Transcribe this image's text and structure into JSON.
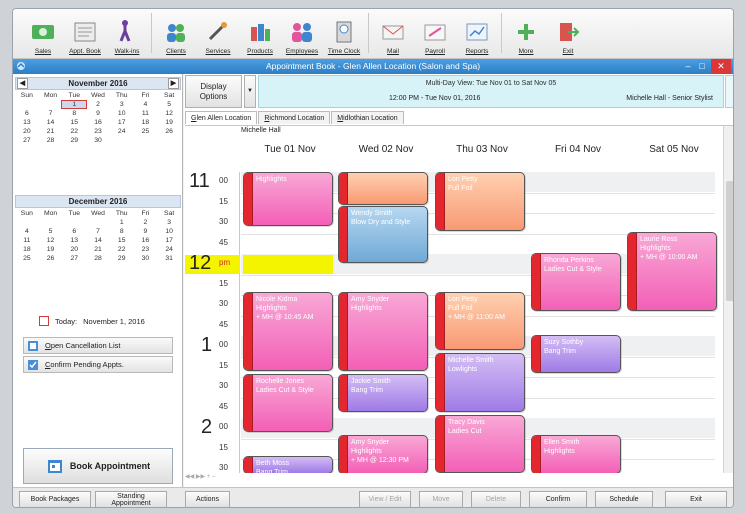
{
  "toolbar": [
    {
      "label": "Sales",
      "icon": "sales-icon"
    },
    {
      "label": "Appt. Book",
      "icon": "appt-book-icon"
    },
    {
      "label": "Walk-ins",
      "icon": "walk-ins-icon"
    },
    {
      "label": "Clients",
      "icon": "clients-icon"
    },
    {
      "label": "Services",
      "icon": "services-icon"
    },
    {
      "label": "Products",
      "icon": "products-icon"
    },
    {
      "label": "Employees",
      "icon": "employees-icon"
    },
    {
      "label": "Time Clock",
      "icon": "time-clock-icon"
    },
    {
      "label": "Mail",
      "icon": "mail-icon"
    },
    {
      "label": "Payroll",
      "icon": "payroll-icon"
    },
    {
      "label": "Reports",
      "icon": "reports-icon"
    },
    {
      "label": "More",
      "icon": "more-icon"
    },
    {
      "label": "Exit",
      "icon": "exit-icon"
    }
  ],
  "window": {
    "title": "Appointment Book - Glen Allen Location (Salon and Spa)"
  },
  "left": {
    "nov": {
      "title": "November 2016",
      "dow": [
        "Sun",
        "Mon",
        "Tue",
        "Wed",
        "Thu",
        "Fri",
        "Sat"
      ],
      "days": [
        "",
        "",
        "1",
        "2",
        "3",
        "4",
        "5",
        "6",
        "7",
        "8",
        "9",
        "10",
        "11",
        "12",
        "13",
        "14",
        "15",
        "16",
        "17",
        "18",
        "19",
        "20",
        "21",
        "22",
        "23",
        "24",
        "25",
        "26",
        "27",
        "28",
        "29",
        "30",
        "",
        "",
        ""
      ]
    },
    "dec": {
      "title": "December 2016",
      "dow": [
        "Sun",
        "Mon",
        "Tue",
        "Wed",
        "Thu",
        "Fri",
        "Sat"
      ],
      "days": [
        "",
        "",
        "",
        "",
        "1",
        "2",
        "3",
        "4",
        "5",
        "6",
        "7",
        "8",
        "9",
        "10",
        "11",
        "12",
        "13",
        "14",
        "15",
        "16",
        "17",
        "18",
        "19",
        "20",
        "21",
        "22",
        "23",
        "24",
        "25",
        "26",
        "27",
        "28",
        "29",
        "30",
        "31"
      ]
    },
    "today_label": "Today:",
    "today_date": "November 1, 2016",
    "open_cancellation": "Open Cancellation List",
    "confirm_pending": "Confirm Pending Appts.",
    "book_appointment": "Book Appointment"
  },
  "main": {
    "display_options": "Display Options",
    "multi_day_view": "Multi-Day View: Tue Nov 01 to Sat Nov 05",
    "current_time": "12:00 PM - Tue Nov 01, 2016",
    "current_staff": "Michelle Hall - Senior Stylist",
    "tabs": [
      "Glen Allen Location",
      "Richmond Location",
      "Midlothian Location"
    ],
    "stylist": "Michelle Hall",
    "days": [
      "Tue 01 Nov",
      "Wed 02 Nov",
      "Thu 03 Nov",
      "Fri 04 Nov",
      "Sat 05 Nov"
    ]
  },
  "time_slots": [
    {
      "hour": "11",
      "min": "00"
    },
    {
      "hour": "",
      "min": "15"
    },
    {
      "hour": "",
      "min": "30"
    },
    {
      "hour": "",
      "min": "45"
    },
    {
      "hour": "12",
      "min": "pm"
    },
    {
      "hour": "",
      "min": "15"
    },
    {
      "hour": "",
      "min": "30"
    },
    {
      "hour": "",
      "min": "45"
    },
    {
      "hour": "1",
      "min": "00"
    },
    {
      "hour": "",
      "min": "15"
    },
    {
      "hour": "",
      "min": "30"
    },
    {
      "hour": "",
      "min": "45"
    },
    {
      "hour": "2",
      "min": "00"
    },
    {
      "hour": "",
      "min": "15"
    },
    {
      "hour": "",
      "min": "30"
    }
  ],
  "appointments": [
    {
      "day": 0,
      "start": -0.3,
      "dur": 2.9,
      "color": "pink",
      "lines": [
        "Highlights"
      ]
    },
    {
      "day": 1,
      "start": -0.3,
      "dur": 1.85,
      "color": "salmon",
      "lines": [
        ""
      ]
    },
    {
      "day": 1,
      "start": 1.6,
      "dur": 2.8,
      "color": "blue",
      "lines": [
        "Wendy Smith",
        "Blow Dry and Style"
      ]
    },
    {
      "day": 2,
      "start": -0.1,
      "dur": 2.95,
      "color": "salmon",
      "lines": [
        "Lori Petty",
        "Full Foil"
      ]
    },
    {
      "day": 3,
      "start": 3.9,
      "dur": 2.85,
      "color": "pink",
      "lines": [
        "Rhonda Perkins",
        "Ladies Cut & Style"
      ]
    },
    {
      "day": 4,
      "start": 2.9,
      "dur": 3.85,
      "color": "pink",
      "lines": [
        "Laurie Ross",
        "Highlights",
        "+ MH @ 10:00 AM"
      ]
    },
    {
      "day": 0,
      "start": 5.8,
      "dur": 3.85,
      "color": "pink",
      "lines": [
        "Nicole Kidma",
        "Highlights",
        "+ MH @ 10:45 AM"
      ]
    },
    {
      "day": 1,
      "start": 5.8,
      "dur": 3.85,
      "color": "pink",
      "lines": [
        "Amy Snyder",
        "Highlights"
      ]
    },
    {
      "day": 2,
      "start": 5.8,
      "dur": 2.85,
      "color": "salmon",
      "lines": [
        "Lori Petty",
        "Full Foil",
        "+ MH @ 11:00 AM"
      ]
    },
    {
      "day": 3,
      "start": 7.9,
      "dur": 1.85,
      "color": "purple",
      "lines": [
        "Suzy Sothby",
        "Bang Trim"
      ]
    },
    {
      "day": 2,
      "start": 8.8,
      "dur": 2.85,
      "color": "purple",
      "lines": [
        "Michelle Smith",
        "Lowlights"
      ]
    },
    {
      "day": 0,
      "start": 9.8,
      "dur": 2.85,
      "color": "pink",
      "lines": [
        "Rochelle Jones",
        "Ladies Cut & Style"
      ]
    },
    {
      "day": 1,
      "start": 9.8,
      "dur": 1.85,
      "color": "purple",
      "lines": [
        "Jackie Smith",
        "Bang Trim"
      ]
    },
    {
      "day": 2,
      "start": 11.8,
      "dur": 2.85,
      "color": "pink",
      "lines": [
        "Tracy Davis",
        "Ladies Cut"
      ]
    },
    {
      "day": 1,
      "start": 12.8,
      "dur": 2.85,
      "color": "pink",
      "lines": [
        "Amy Snyder",
        "Highlights",
        "+ MH @ 12:30 PM"
      ]
    },
    {
      "day": 3,
      "start": 12.8,
      "dur": 2.85,
      "color": "pink",
      "lines": [
        "Ellen Smith",
        "Highlights"
      ]
    },
    {
      "day": 0,
      "start": 13.8,
      "dur": 1.85,
      "color": "purple",
      "lines": [
        "Beth Moss",
        "Bang Trim"
      ]
    }
  ],
  "bottom": {
    "book_packages": "Book Packages",
    "standing_1": "Standing",
    "standing_2": "Appointment",
    "actions": "Actions",
    "view_edit": "View / Edit",
    "move": "Move",
    "delete": "Delete",
    "confirm": "Confirm",
    "schedule": "Schedule",
    "exit": "Exit"
  }
}
